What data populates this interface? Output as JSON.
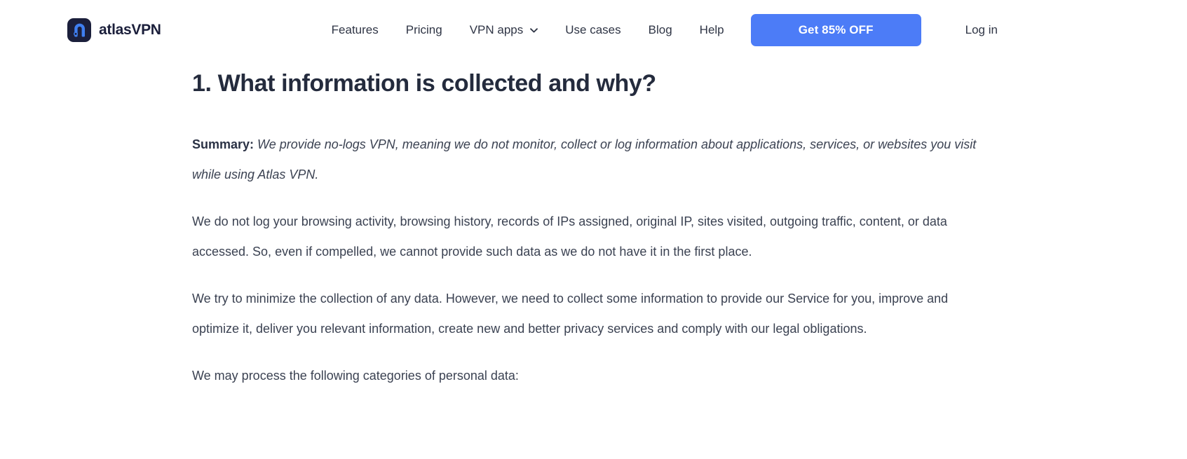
{
  "header": {
    "brand": {
      "name": "atlasVPN",
      "icon": "atlas-vpn-logo-icon",
      "mark_bg": "#1b1f3b",
      "mark_fg": "#3f7ff0"
    },
    "nav": [
      {
        "label": "Features",
        "has_dropdown": false
      },
      {
        "label": "Pricing",
        "has_dropdown": false
      },
      {
        "label": "VPN apps",
        "has_dropdown": true,
        "dropdown_icon": "chevron-down-icon"
      },
      {
        "label": "Use cases",
        "has_dropdown": false
      },
      {
        "label": "Blog",
        "has_dropdown": false
      },
      {
        "label": "Help",
        "has_dropdown": false
      }
    ],
    "cta": {
      "label": "Get 85% OFF",
      "background": "#4c7cf7",
      "text_color": "#ffffff"
    },
    "login": {
      "label": "Log in"
    }
  },
  "article": {
    "heading": "1. What information is collected and why?",
    "summary": {
      "label": "Summary:",
      "text": "We provide no-logs VPN, meaning we do not monitor, collect or log information about applications, services, or websites you visit while using Atlas VPN."
    },
    "paragraphs": [
      "We do not log your browsing activity, browsing history, records of IPs assigned, original IP, sites visited, outgoing traffic, content, or data accessed. So, even if compelled, we cannot provide such data as we do not have it in the first place.",
      "We try to minimize the collection of any data. However, we need to collect some information to provide our Service for you, improve and optimize it, deliver you relevant information, create new and better privacy services and comply with our legal obligations.",
      "We may process the following categories of personal data:"
    ]
  },
  "theme": {
    "page_background": "#ffffff",
    "text_color": "#3b4252",
    "heading_color": "#242b3d",
    "accent": "#4c7cf7"
  }
}
